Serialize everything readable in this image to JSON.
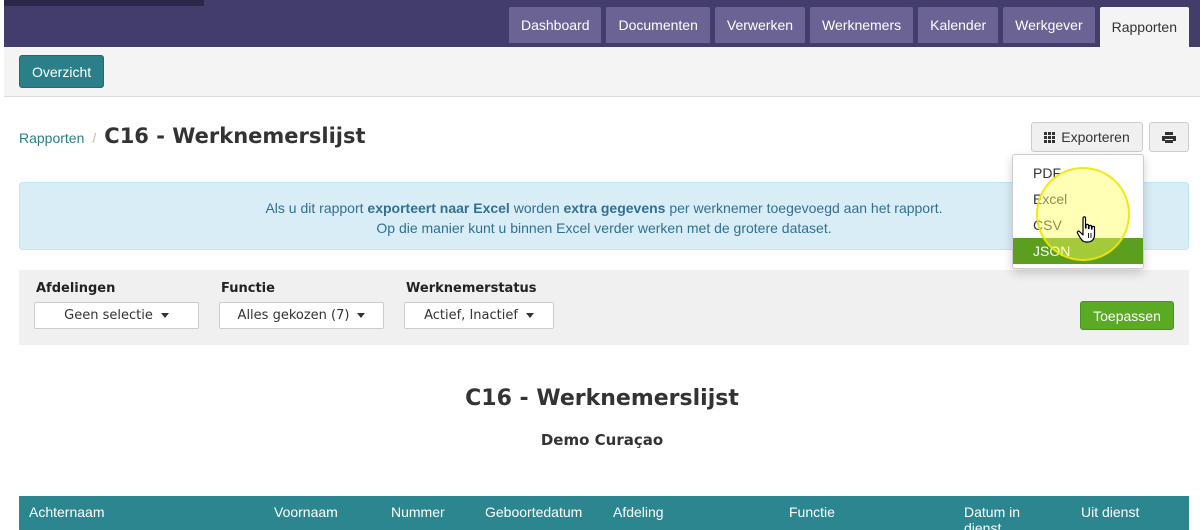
{
  "nav": {
    "tabs": [
      {
        "label": "Dashboard"
      },
      {
        "label": "Documenten"
      },
      {
        "label": "Verwerken"
      },
      {
        "label": "Werknemers"
      },
      {
        "label": "Kalender"
      },
      {
        "label": "Werkgever"
      },
      {
        "label": "Rapporten",
        "active": true
      }
    ]
  },
  "subnav": {
    "overview_label": "Overzicht"
  },
  "breadcrumb": {
    "link": "Rapporten",
    "separator": "/",
    "title": "C16 - Werknemerslijst"
  },
  "toolbar": {
    "export_label": "Exporteren"
  },
  "export_menu": {
    "items": [
      "PDF",
      "Excel",
      "CSV",
      "JSON"
    ],
    "highlighted": "JSON"
  },
  "alert": {
    "line1_a": "Als u dit rapport ",
    "line1_b": "exporteert naar Excel",
    "line1_c": " worden ",
    "line1_d": "extra gegevens",
    "line1_e": " per werknemer toegevoegd aan het rapport.",
    "line2": "Op die manier kunt u binnen Excel verder werken met de grotere dataset."
  },
  "filters": {
    "departments": {
      "label": "Afdelingen",
      "value": "Geen selectie"
    },
    "function": {
      "label": "Functie",
      "value": "Alles gekozen (7)"
    },
    "status": {
      "label": "Werknemerstatus",
      "value": "Actief, Inactief"
    },
    "apply_label": "Toepassen"
  },
  "report": {
    "title": "C16 - Werknemerslijst",
    "subtitle": "Demo Curaçao"
  },
  "table": {
    "columns": [
      "Achternaam",
      "Voornaam",
      "Nummer",
      "Geboortedatum",
      "Afdeling",
      "Functie",
      "Datum in dienst",
      "Uit dienst"
    ]
  },
  "colors": {
    "nav": "#433d6c",
    "tab": "#6a6393",
    "primary": "#2b7f88",
    "success": "#5aab23",
    "table_header": "#2b8690"
  }
}
